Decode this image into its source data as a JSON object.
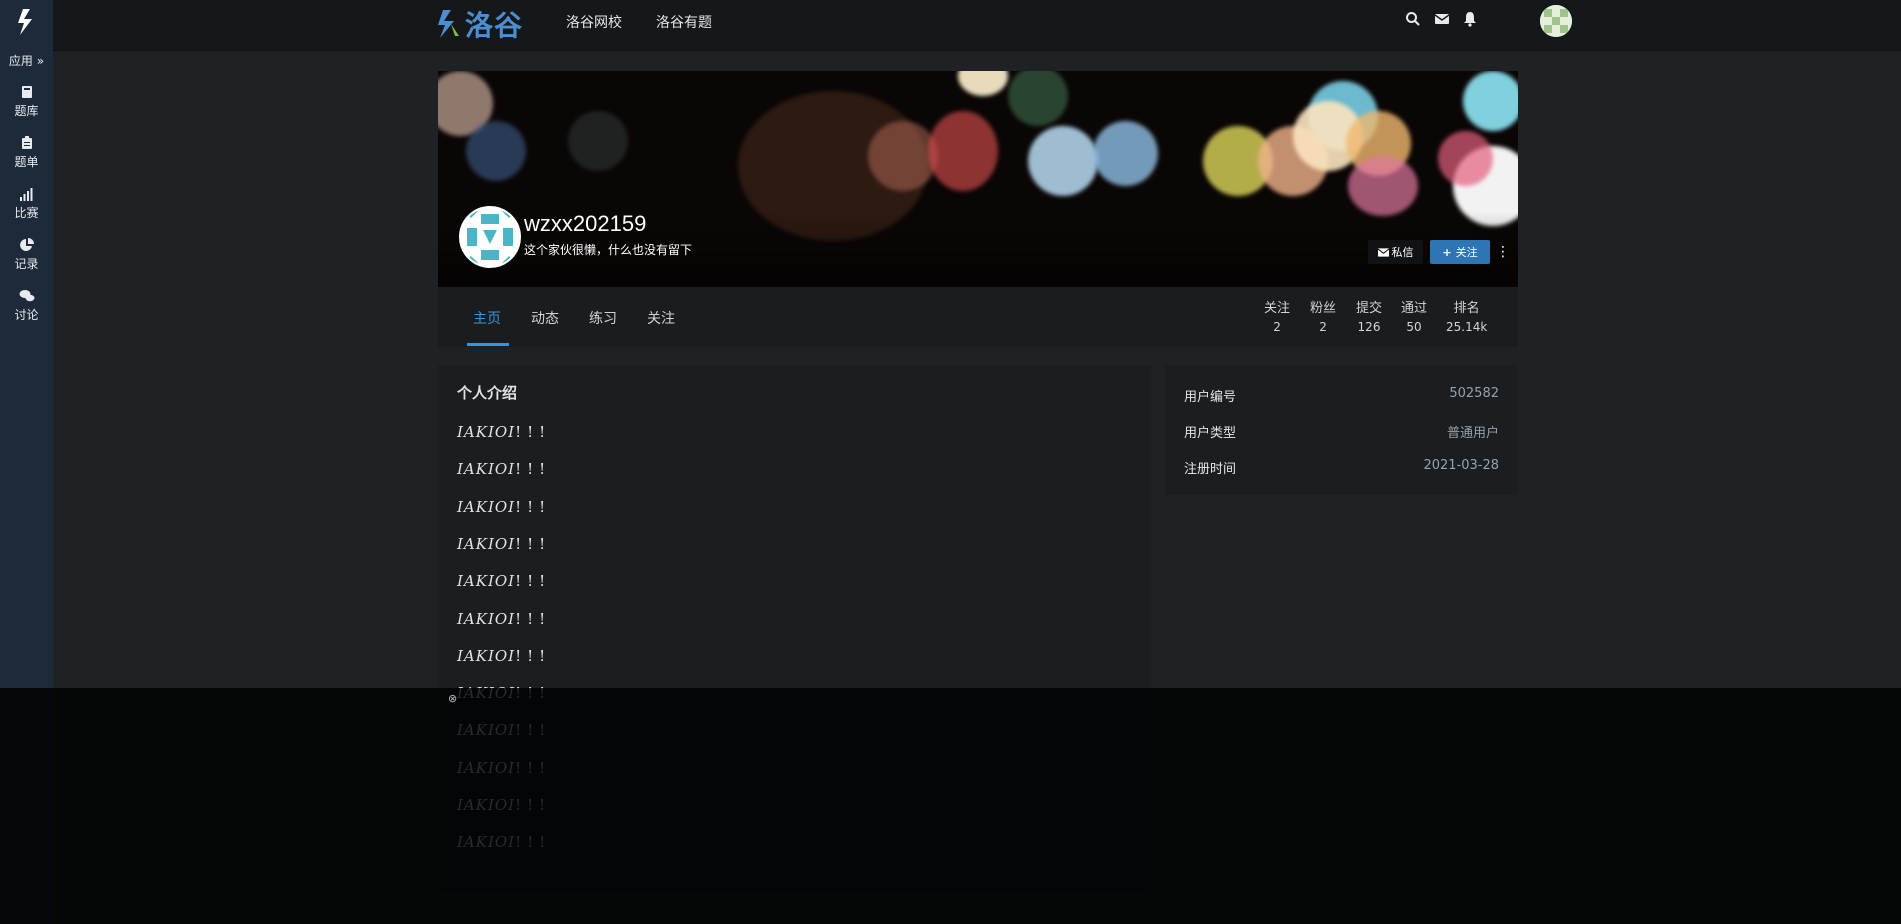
{
  "sidebar": {
    "app_label": "应用 »",
    "items": [
      {
        "icon": "book-icon",
        "label": "题库"
      },
      {
        "icon": "clipboard-icon",
        "label": "题单"
      },
      {
        "icon": "signal-bars-icon",
        "label": "比赛"
      },
      {
        "icon": "pie-chart-icon",
        "label": "记录"
      },
      {
        "icon": "comments-icon",
        "label": "讨论"
      }
    ]
  },
  "header": {
    "brand": "洛谷",
    "nav": [
      "洛谷网校",
      "洛谷有题"
    ],
    "icons": [
      "search-icon",
      "mail-icon",
      "bell-icon"
    ]
  },
  "profile": {
    "username": "wzxx202159",
    "bio": "这个家伙很懒，什么也没有留下",
    "message_button": "私信",
    "follow_button": "关注"
  },
  "tabs": [
    "主页",
    "动态",
    "练习",
    "关注"
  ],
  "active_tab": "主页",
  "stats": [
    {
      "label": "关注",
      "value": "2"
    },
    {
      "label": "粉丝",
      "value": "2"
    },
    {
      "label": "提交",
      "value": "126"
    },
    {
      "label": "通过",
      "value": "50"
    },
    {
      "label": "排名",
      "value": "25.14k"
    }
  ],
  "intro": {
    "title": "个人介绍",
    "lines": [
      {
        "text": "IAKIOI",
        "suffix": "!!!"
      },
      {
        "text": "IAKIOI",
        "suffix": "!!!"
      },
      {
        "text": "IAKIOI",
        "suffix": "!!!"
      },
      {
        "text": "IAKIOI",
        "suffix": "!!!"
      },
      {
        "text": "IAKIOI",
        "suffix": "!!!"
      },
      {
        "text": "IAKIOI",
        "suffix": "!!!"
      },
      {
        "text": "IAKIOI",
        "suffix": "!!!"
      },
      {
        "text": "IAKIOI",
        "suffix": "!!!"
      },
      {
        "text": "IAKIOI",
        "suffix": "!!!"
      },
      {
        "text": "IAKIOI",
        "suffix": "!!!"
      },
      {
        "text": "IAKIOI",
        "suffix": "!!!"
      },
      {
        "text": "IAKIOI",
        "suffix": "!!!"
      }
    ]
  },
  "info": [
    {
      "key": "用户编号",
      "value": "502582"
    },
    {
      "key": "用户类型",
      "value": "普通用户"
    },
    {
      "key": "注册时间",
      "value": "2021-03-28"
    }
  ],
  "colors": {
    "accent": "#3e94d6",
    "follow_button": "#2e75b6",
    "sidebar_bg": "#1c2a3a",
    "page_bg": "#1f2225"
  }
}
